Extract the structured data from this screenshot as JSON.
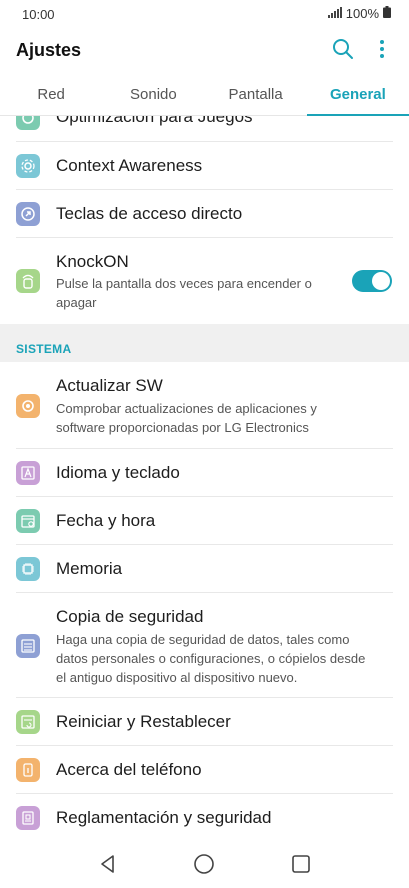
{
  "status_bar": {
    "time": "10:00",
    "battery": "100%"
  },
  "app_bar": {
    "title": "Ajustes",
    "icons": [
      "search-icon",
      "more-vert-icon"
    ]
  },
  "tabs": [
    {
      "label": "Red",
      "active": false
    },
    {
      "label": "Sonido",
      "active": false
    },
    {
      "label": "Pantalla",
      "active": false
    },
    {
      "label": "General",
      "active": true
    }
  ],
  "colors": {
    "accent": "#1aa3b8"
  },
  "settings": {
    "optimizacion": {
      "title": "Optimización para Juegos",
      "icon": "gamepad-icon",
      "color": "#7ccbb0"
    },
    "context": {
      "title": "Context Awareness",
      "icon": "context-awareness-icon",
      "color": "#7cc7d6"
    },
    "teclas": {
      "title": "Teclas de acceso directo",
      "icon": "shortcut-icon",
      "color": "#8ea0d4"
    },
    "knockon": {
      "title": "KnockON",
      "subtitle": "Pulse la pantalla dos veces para encender o apagar",
      "icon": "knock-icon",
      "color": "#a6d68a",
      "enabled": true
    }
  },
  "section_sistema": "SISTEMA",
  "sistema": {
    "actualizar": {
      "title": "Actualizar SW",
      "subtitle": "Comprobar actualizaciones de aplicaciones y software proporcionadas por LG Electronics",
      "icon": "update-icon",
      "color": "#f3b36d"
    },
    "idioma": {
      "title": "Idioma y teclado",
      "icon": "language-icon",
      "color": "#c8a0d6"
    },
    "fecha": {
      "title": "Fecha y hora",
      "icon": "calendar-icon",
      "color": "#7ccbb0"
    },
    "memoria": {
      "title": "Memoria",
      "icon": "memory-chip-icon",
      "color": "#7cc7d6"
    },
    "copia": {
      "title": "Copia de seguridad",
      "subtitle": "Haga una copia de seguridad de datos, tales como datos personales o configuraciones, o cópielos desde el antiguo dispositivo al dispositivo nuevo.",
      "icon": "backup-icon",
      "color": "#8ea0d4"
    },
    "reiniciar": {
      "title": "Reiniciar y Restablecer",
      "icon": "reset-icon",
      "color": "#a6d68a"
    },
    "acerca": {
      "title": "Acerca del teléfono",
      "icon": "phone-info-icon",
      "color": "#f3b36d"
    },
    "reglamentacion": {
      "title": "Reglamentación y seguridad",
      "icon": "regulatory-icon",
      "color": "#c8a0d6"
    }
  },
  "nav_bar": {
    "icons": [
      "back-icon",
      "home-icon",
      "recents-icon"
    ]
  }
}
